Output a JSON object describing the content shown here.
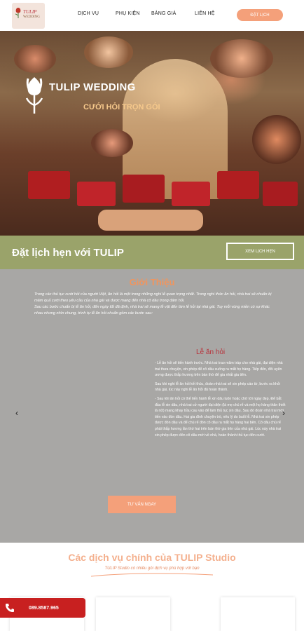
{
  "header": {
    "logo_text": "TULIP",
    "logo_sub": "WEDDING",
    "nav": [
      "DỊCH VỤ",
      "PHỤ KIỆN",
      "BẢNG GIÁ",
      "LIÊN HỆ"
    ],
    "book_label": "ĐẶT LỊCH"
  },
  "hero": {
    "title": "TULIP WEDDING",
    "subtitle": "CƯỚI HỎI TRỌN GÓI"
  },
  "band": {
    "title": "Đặt lịch hẹn với TULIP",
    "button_label": "XEM LỊCH HẸN"
  },
  "intro": {
    "title": "Giới Thiệu",
    "p1": "Trong các thủ tục cưới hỏi của người Việt, ăn hỏi là một trong những nghi lễ quan trọng nhất. Trong nghi thức ăn hỏi, nhà trai sẽ chuẩn bị mâm quả cưới theo yêu cầu của nhà gái và được mang đến nhà cô dâu trong đám hỏi.",
    "p2": "Sau các bước chuẩn bị lễ ăn hỏi, đến ngày tốt đã định, nhà trai sẽ mang lễ vật đến làm lễ hỏi tại nhà gái. Tuy mỗi vùng miền có sự khác nhau nhưng nhìn chung, trình tự lễ ăn hỏi chuẩn gồm các bước sau:",
    "slide_title": "Lễ ăn hỏi",
    "slide_p1": "- Lễ ăn hỏi sẽ tiến hành trước. Nhà trai trao mâm tráp cho nhà gái, đại diện nhà trai thưa chuyện, xin phép để cô dâu xuống ra mắt họ hàng. Tiếp đến, đôi uyên ương được thắp hương trên bàn thờ để gia nhất gia tiên.",
    "slide_p2": "Sau khi nghi lễ ăn hỏi kết thúc, đoàn nhà trai sẽ xin phép cáo từ, bước ra khỏi nhà gái, lúc này nghi lễ ăn hỏi đã hoàn thành.",
    "slide_p3": "- Sau khi ăn hỏi có thể tiến hành lễ xin dâu luôn hoặc chờ tới ngày đẹp. Để bắt đầu lễ xin dâu, nhà trai cử người đại diện (là mẹ chú rể và một họ hàng thân thiết là nữ) mang khay trầu cau vào để làm thủ tục xin dâu. Sau đó đoàn nhà trai mới tiến vào đón dâu. Hai gia đình chuyện trò, nêu lý do buổi lễ. Nhà trai xin phép được đón dâu và để chú rể đón cô dâu ra mắt họ hàng hai bên. Cô dâu chú rể phải thắp hương lần thứ hai trên bàn thờ gia tiên của nhà gái. Lúc này nhà trai xin phép được đón cô dâu mới về nhà, hoàn thành thủ tục đón cưới.",
    "prev_arrow": "‹",
    "next_arrow": "›",
    "consult_label": "TƯ VẤN NGAY"
  },
  "services": {
    "title": "Các dịch vụ chính của TULIP Studio",
    "subtitle": "TULIP Studio có nhiều gói dịch vụ phù hợp với bạn"
  },
  "phone": {
    "number": "089.8587.965"
  },
  "colors": {
    "accent": "#f4a07a",
    "band": "#9aa36a",
    "intro_bg": "#a8a7a5",
    "phone": "#c82020",
    "slide_title": "#b8323b"
  }
}
